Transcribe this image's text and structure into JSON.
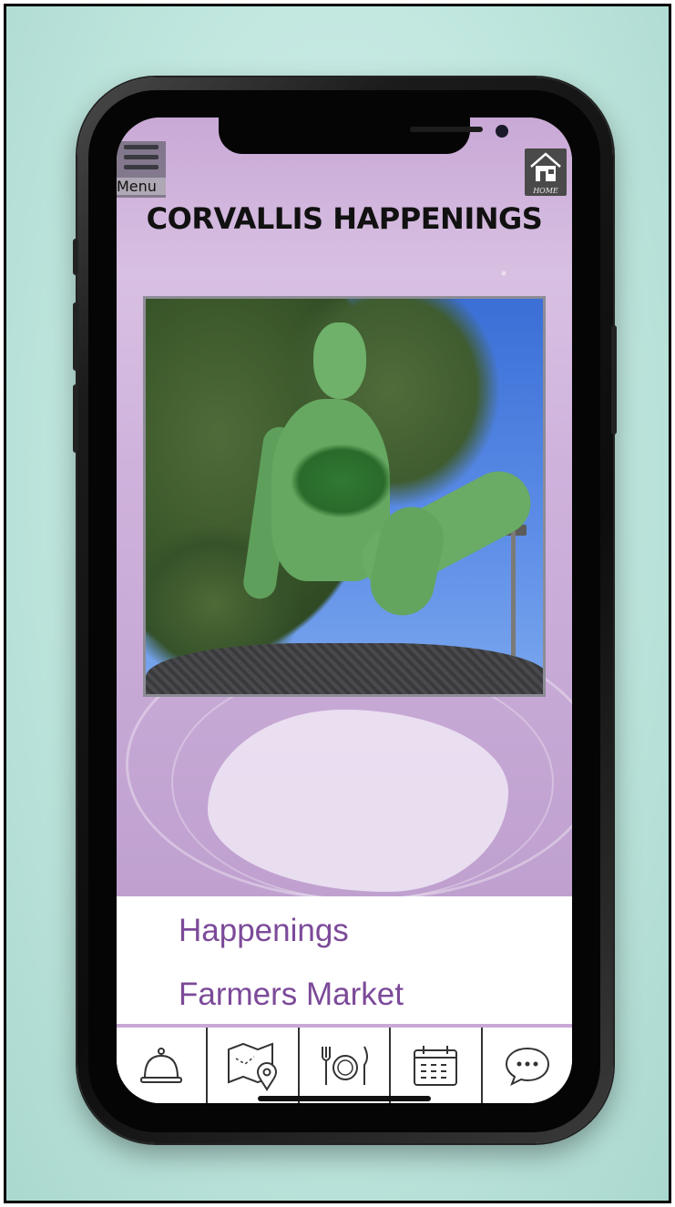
{
  "app": {
    "title": "CORVALLIS HAPPENINGS",
    "menu_label": "Menu",
    "home_label": "HOME"
  },
  "colors": {
    "accent_purple": "#7c4a99",
    "hero_lavender": "#c9a8d6",
    "background_mint": "#bfe6de"
  },
  "hero_image": {
    "subject": "green statue sitting among pine trees"
  },
  "menu": {
    "items": [
      {
        "label": "Happenings"
      },
      {
        "label": "Farmers Market"
      }
    ]
  },
  "tabbar": {
    "tabs": [
      {
        "icon": "service-bell-icon"
      },
      {
        "icon": "map-location-icon"
      },
      {
        "icon": "dining-icon"
      },
      {
        "icon": "calendar-icon"
      },
      {
        "icon": "chat-bubble-icon"
      }
    ]
  }
}
